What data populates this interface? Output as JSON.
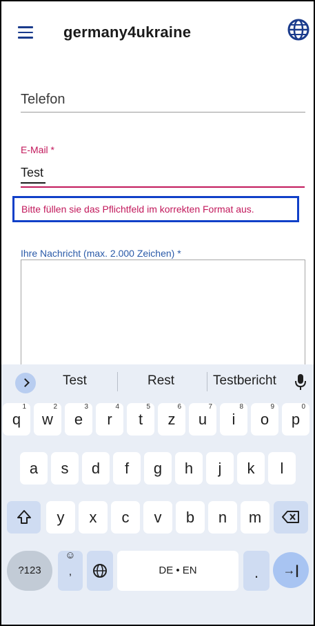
{
  "app": {
    "title": "germany4ukraine"
  },
  "form": {
    "phone_label": "Telefon",
    "email_label": "E-Mail *",
    "email_value": "Test",
    "email_error": "Bitte füllen sie das Pflichtfeld im korrekten Format aus.",
    "message_label": "Ihre Nachricht (max. 2.000 Zeichen) *",
    "message_value": ""
  },
  "keyboard": {
    "suggestions": [
      "Test",
      "Rest",
      "Testbericht"
    ],
    "row1": [
      {
        "k": "q",
        "h": "1"
      },
      {
        "k": "w",
        "h": "2"
      },
      {
        "k": "e",
        "h": "3"
      },
      {
        "k": "r",
        "h": "4"
      },
      {
        "k": "t",
        "h": "5"
      },
      {
        "k": "z",
        "h": "6"
      },
      {
        "k": "u",
        "h": "7"
      },
      {
        "k": "i",
        "h": "8"
      },
      {
        "k": "o",
        "h": "9"
      },
      {
        "k": "p",
        "h": "0"
      }
    ],
    "row2": [
      "a",
      "s",
      "d",
      "f",
      "g",
      "h",
      "j",
      "k",
      "l"
    ],
    "row3": [
      "y",
      "x",
      "c",
      "v",
      "b",
      "n",
      "m"
    ],
    "symbols_label": "?123",
    "emoji_label": "☺",
    "comma_label": ",",
    "space_label": "DE • EN",
    "period_label": ".",
    "enter_label": "→|",
    "shift_label": "⇧",
    "icons": {
      "shift": "shift-icon",
      "backspace": "backspace-icon",
      "globe": "globe-icon",
      "mic": "mic-icon",
      "expand": "chevron-right-icon"
    }
  },
  "colors": {
    "brand": "#1a3b8c",
    "error": "#c2185b",
    "highlight_box": "#1040c8",
    "label_blue": "#2a5aa8"
  }
}
